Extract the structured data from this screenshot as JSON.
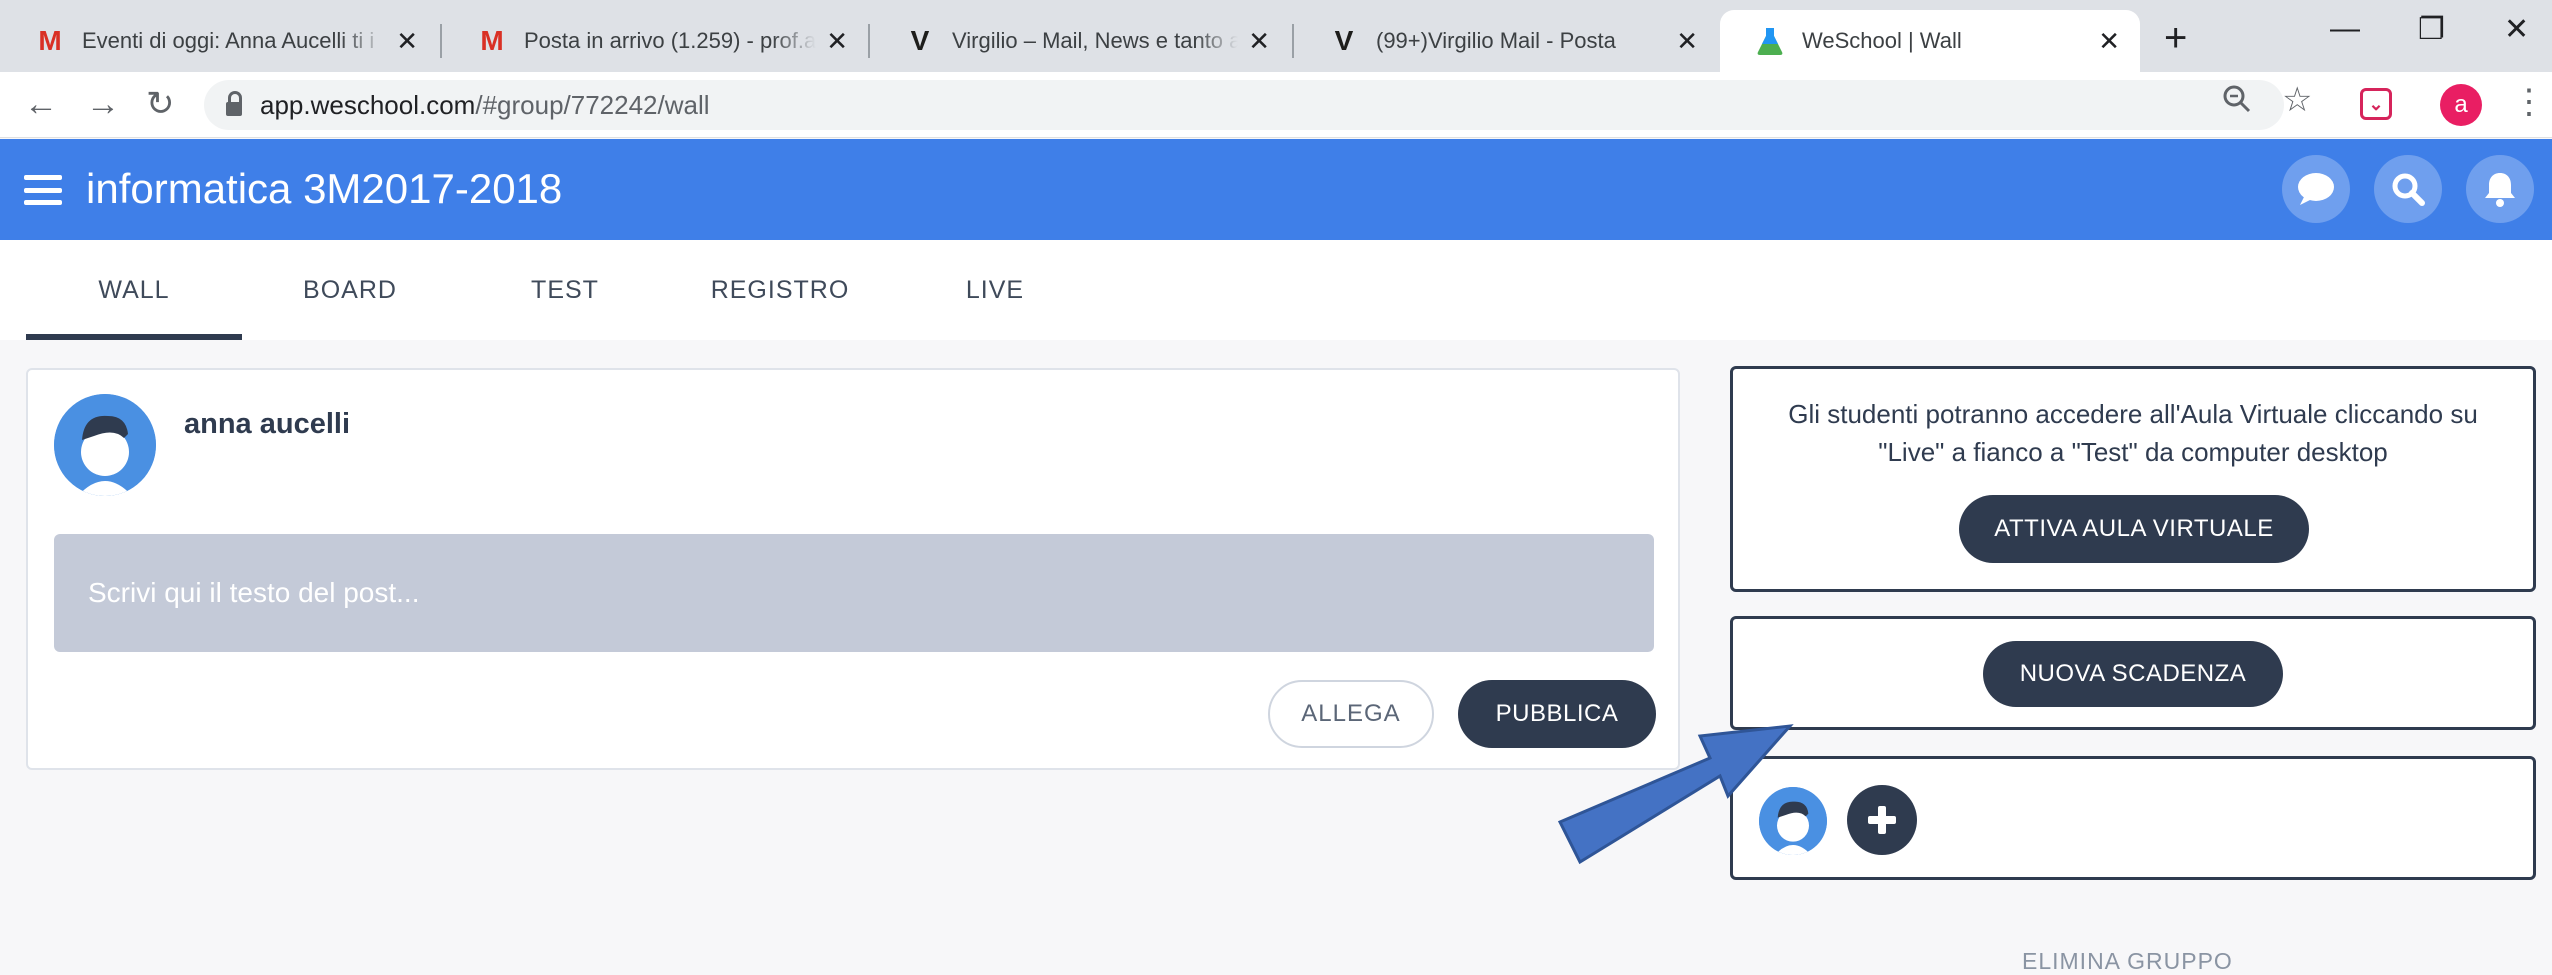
{
  "browser": {
    "tabs": [
      {
        "title": "Eventi di oggi: Anna Aucelli ti i",
        "favicon": "gmail-icon"
      },
      {
        "title": "Posta in arrivo (1.259) - prof.au",
        "favicon": "gmail-icon"
      },
      {
        "title": "Virgilio – Mail, News e tanto al",
        "favicon": "virgilio-icon"
      },
      {
        "title": "(99+)Virgilio Mail - Posta",
        "favicon": "virgilio-icon"
      },
      {
        "title": "WeSchool | Wall",
        "favicon": "weschool-flask-icon"
      }
    ],
    "url_host": "app.weschool.com",
    "url_path": "/#group/772242/wall",
    "profile_initial": "a"
  },
  "app": {
    "title": "informatica 3M2017-2018",
    "tabs": [
      "WALL",
      "BOARD",
      "TEST",
      "REGISTRO",
      "LIVE"
    ],
    "active_tab": "WALL"
  },
  "composer": {
    "author": "anna aucelli",
    "placeholder": "Scrivi qui il testo del post...",
    "attach_label": "ALLEGA",
    "publish_label": "PUBBLICA"
  },
  "sidebar": {
    "virtual_room_text": "Gli studenti potranno accedere all'Aula Virtuale cliccando su \"Live\" a fianco a \"Test\" da computer desktop",
    "virtual_room_button": "ATTIVA AULA VIRTUALE",
    "deadline_button": "NUOVA SCADENZA",
    "delete_group": "ELIMINA GRUPPO"
  },
  "colors": {
    "brand_blue": "#3f7fe8",
    "dark_navy": "#2f3b4f",
    "annotation_arrow": "#4472c4"
  }
}
